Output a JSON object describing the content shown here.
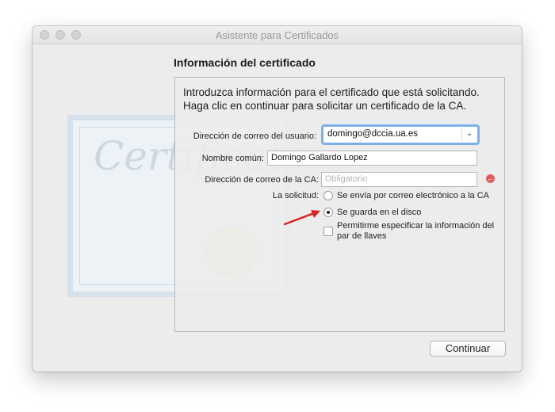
{
  "window": {
    "title": "Asistente para Certificados"
  },
  "heading": "Información del certificado",
  "intro": "Introduzca información para el certificado que está solicitando. Haga clic en continuar para solicitar un certificado de la CA.",
  "form": {
    "user_email_label": "Dirección de correo del usuario:",
    "user_email_value": "domingo@dccia.ua.es",
    "common_name_label": "Nombre común:",
    "common_name_value": "Domingo Gallardo Lopez",
    "ca_email_label": "Dirección de correo de la CA:",
    "ca_email_placeholder": "Obligatorio",
    "request_label": "La solicitud:",
    "option_email": "Se envía por correo electrónico a la CA",
    "option_disk": "Se guarda en el disco",
    "option_keypair": "Permitirme especificar la información del par de llaves",
    "selected_option": "option_disk"
  },
  "continue_label": "Continuar",
  "colors": {
    "accent_focus": "#7bb0ea",
    "arrow": "#e02020",
    "warning": "#e05b5b"
  }
}
